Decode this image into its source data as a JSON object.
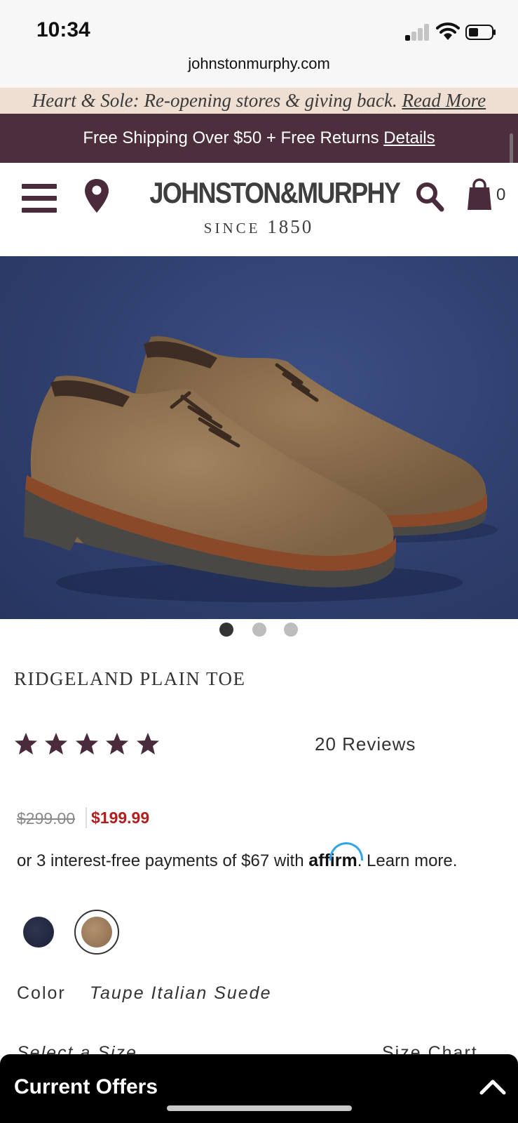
{
  "status_bar": {
    "time": "10:34"
  },
  "browser": {
    "url": "johnstonmurphy.com"
  },
  "promo_banner": {
    "text": "Heart & Sole: Re-opening stores & giving back.",
    "link": "Read More"
  },
  "shipping_banner": {
    "text": "Free Shipping Over $50 + Free Returns",
    "link": "Details"
  },
  "header": {
    "logo_text": "JOHNSTON&MURPHY",
    "logo_since": "SINCE",
    "logo_year": "1850",
    "cart_count": "0",
    "icons": [
      "menu-icon",
      "location-pin-icon",
      "search-icon",
      "shopping-bag-icon"
    ]
  },
  "gallery": {
    "image_count": 3,
    "active_index": 0
  },
  "product": {
    "title": "RIDGELAND PLAIN TOE",
    "rating": 5,
    "reviews": "20 Reviews",
    "price_original": "$299.00",
    "price_sale": "$199.99",
    "affirm": {
      "prefix": "or 3 interest-free payments of $67 with",
      "logo": "affirm",
      "suffix": ". Learn more."
    },
    "swatches": [
      {
        "name": "navy",
        "color": "#252a42",
        "selected": false
      },
      {
        "name": "taupe",
        "color": "#a0805f",
        "selected": true
      }
    ],
    "color_label": "Color",
    "color_value": "Taupe Italian Suede",
    "size_label": "Select a Size",
    "size_chart_label": "Size Chart"
  },
  "offers": {
    "title": "Current Offers"
  },
  "colors": {
    "brand": "#4c2e3d",
    "sale_red": "#b01e1e",
    "banner_beige": "#eedfd2",
    "hero_blue": "#2f3f6e"
  }
}
